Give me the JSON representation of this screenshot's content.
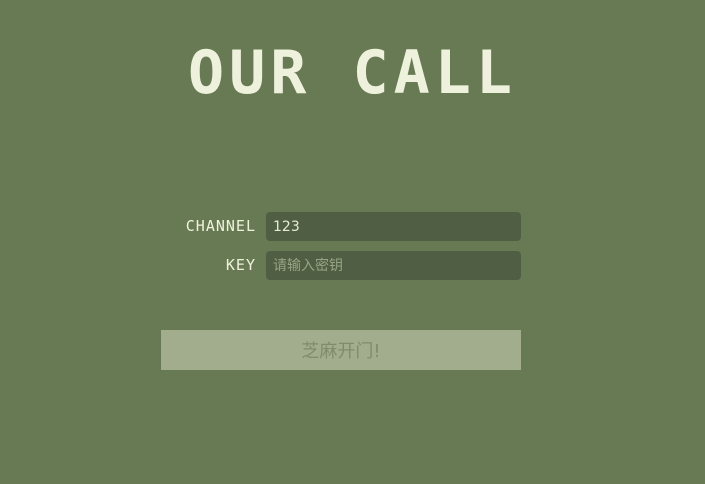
{
  "app": {
    "title": "OUR CALL"
  },
  "form": {
    "channel_label": "CHANNEL",
    "channel_value": "123",
    "key_label": "KEY",
    "key_placeholder": "请输入密钥",
    "submit_label": "芝麻开门!"
  },
  "colors": {
    "background": "#687a53",
    "title_text": "#eef1dc",
    "input_background": "#505f43",
    "button_background": "#a2ad8e",
    "button_text": "#7f8c6b"
  }
}
